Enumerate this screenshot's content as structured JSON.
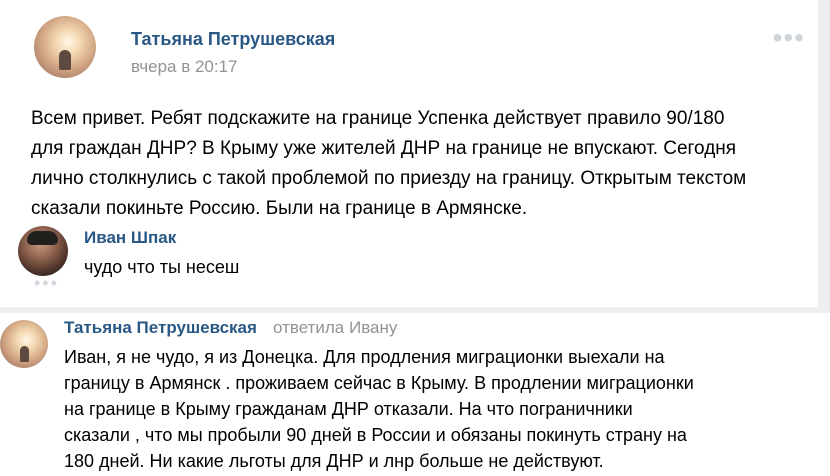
{
  "post": {
    "author": "Татьяна Петрушевская",
    "time": "вчера в 20:17",
    "menu": "•••",
    "lines": [
      "Всем привет. Ребят подскажите на границе Успенка действует правило 90/180",
      "для граждан ДНР? В Крыму уже жителей ДНР на границе не впускают. Сегодня",
      "лично столкнулись с такой проблемой по приезду на границу. Открытым текстом",
      "сказали покиньте Россию. Были на границе в Армянске."
    ],
    "avatar_icon": "sunset-avatar-icon"
  },
  "comment": {
    "author": "Иван Шпак",
    "text": "чудо что ты несеш",
    "avatar_icon": "man-portrait-avatar-icon"
  },
  "more_comments": "•••",
  "reply": {
    "author": "Татьяна Петрушевская",
    "meta": "ответила Ивану",
    "lines": [
      "Иван, я не чудо, я из Донецка. Для продления миграционки выехали на",
      "границу в Армянск . проживаем сейчас в Крыму. В продлении миграционки",
      "на границе в Крыму гражданам ДНР отказали. На что пограничники",
      "сказали , что мы пробыли 90 дней в России и обязаны покинуть страну на",
      "180 дней. Ни какие льготы для ДНР и лнр больше не действуют."
    ],
    "avatar_icon": "sunset-avatar-icon"
  },
  "colors": {
    "link": "#2a5885",
    "muted": "#939393",
    "background": "#edeef0",
    "card": "#ffffff"
  }
}
